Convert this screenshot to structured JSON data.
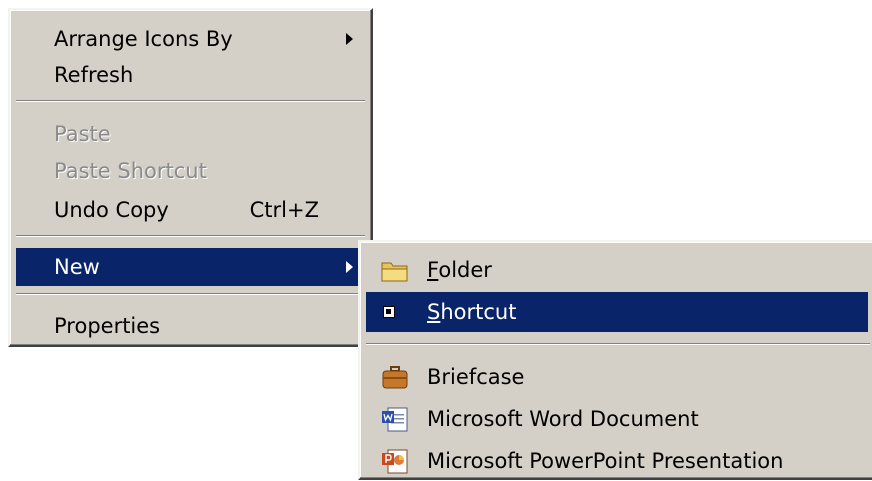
{
  "context_menu": {
    "items": [
      {
        "label": "Arrange Icons By",
        "has_submenu": true,
        "state": "normal"
      },
      {
        "label": "Refresh",
        "state": "normal"
      },
      {
        "label": "Paste",
        "state": "disabled"
      },
      {
        "label": "Paste Shortcut",
        "state": "disabled"
      },
      {
        "label": "Undo Copy",
        "shortcut": "Ctrl+Z",
        "state": "normal"
      },
      {
        "label": "New",
        "has_submenu": true,
        "state": "selected"
      },
      {
        "label": "Properties",
        "state": "normal"
      }
    ]
  },
  "new_submenu": {
    "items": [
      {
        "label_mnemonic": "F",
        "label_rest": "older",
        "icon": "folder-icon",
        "state": "normal"
      },
      {
        "label_mnemonic": "S",
        "label_rest": "hortcut",
        "icon": "shortcut-icon",
        "state": "selected"
      },
      {
        "label": "Briefcase",
        "icon": "briefcase-icon",
        "state": "normal"
      },
      {
        "label": "Microsoft Word Document",
        "icon": "word-document-icon",
        "state": "normal"
      },
      {
        "label": "Microsoft PowerPoint Presentation",
        "icon": "powerpoint-presentation-icon",
        "state": "normal"
      }
    ]
  },
  "colors": {
    "menu_background": "#d4d0c8",
    "selection_background": "#0a246a",
    "selection_text": "#ffffff",
    "disabled_text": "#8a8a8a"
  }
}
